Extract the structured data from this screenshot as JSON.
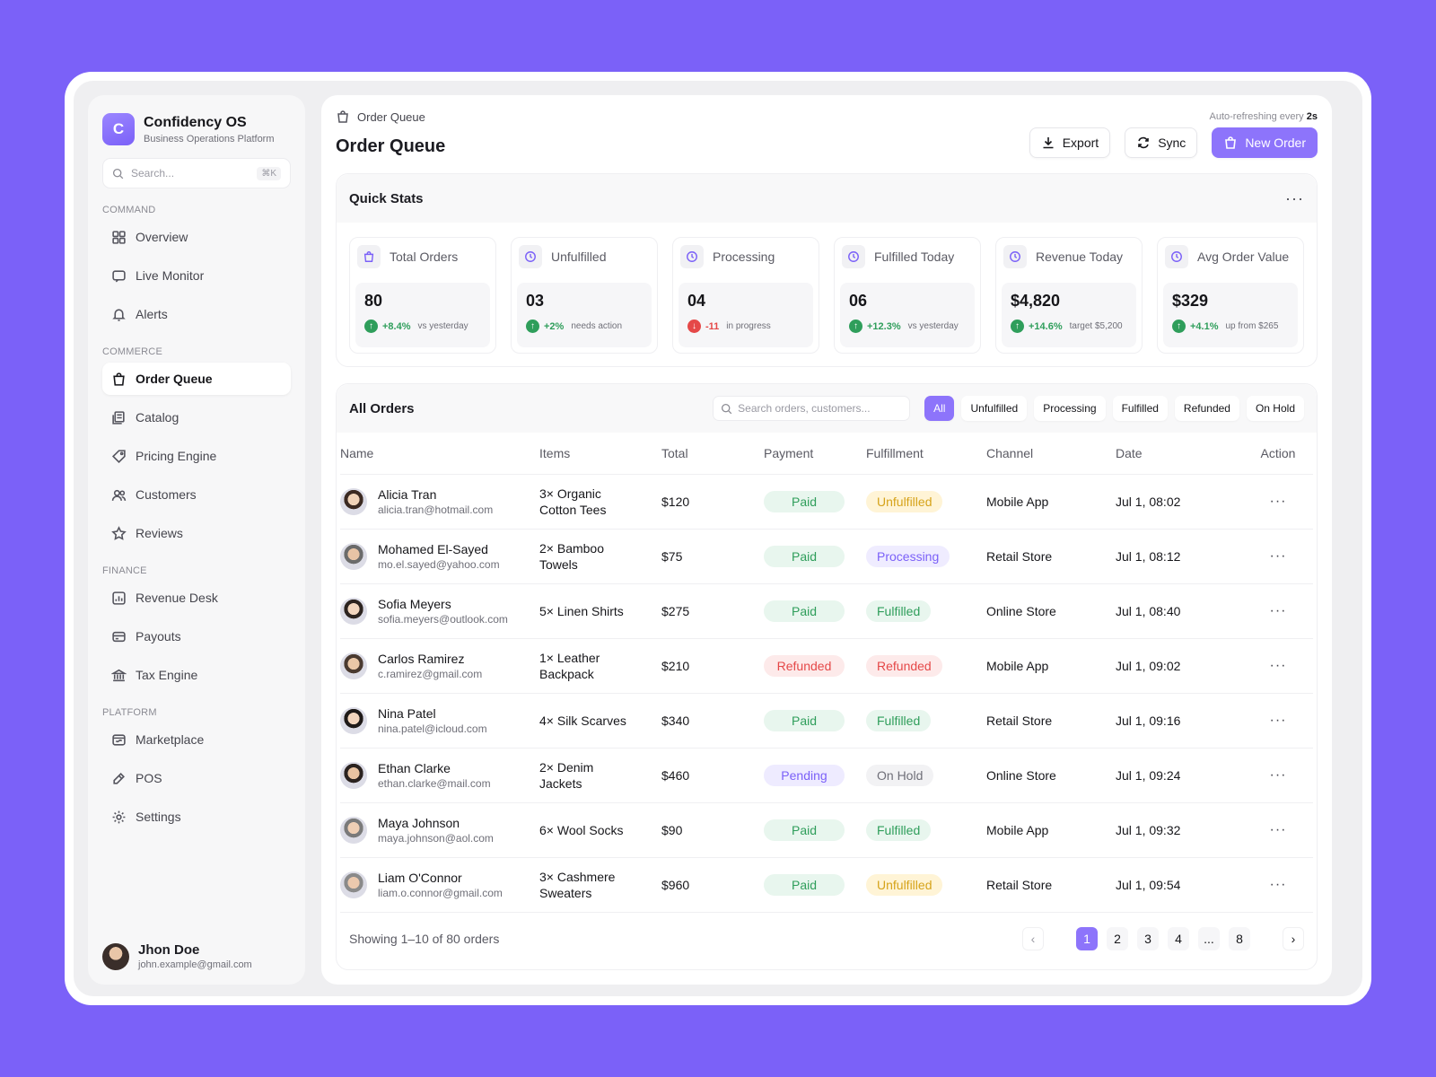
{
  "brand": {
    "logo_letter": "C",
    "title": "Confidency OS",
    "subtitle": "Business Operations Platform"
  },
  "sidebar": {
    "search_placeholder": "Search...",
    "search_shortcut": "⌘K",
    "sections": [
      {
        "label": "COMMAND",
        "items": [
          {
            "label": "Overview",
            "icon": "grid-icon"
          },
          {
            "label": "Live Monitor",
            "icon": "monitor-icon"
          },
          {
            "label": "Alerts",
            "icon": "bell-icon"
          }
        ]
      },
      {
        "label": "COMMERCE",
        "items": [
          {
            "label": "Order Queue",
            "icon": "bag-icon",
            "active": true
          },
          {
            "label": "Catalog",
            "icon": "catalog-icon"
          },
          {
            "label": "Pricing Engine",
            "icon": "tag-icon"
          },
          {
            "label": "Customers",
            "icon": "users-icon"
          },
          {
            "label": "Reviews",
            "icon": "star-icon"
          }
        ]
      },
      {
        "label": "FINANCE",
        "items": [
          {
            "label": "Revenue Desk",
            "icon": "chart-icon"
          },
          {
            "label": "Payouts",
            "icon": "card-icon"
          },
          {
            "label": "Tax Engine",
            "icon": "bank-icon"
          }
        ]
      },
      {
        "label": "PLATFORM",
        "items": [
          {
            "label": "Marketplace",
            "icon": "store-icon"
          },
          {
            "label": "POS",
            "icon": "pos-icon"
          },
          {
            "label": "Settings",
            "icon": "gear-icon"
          }
        ]
      }
    ],
    "user": {
      "name": "Jhon Doe",
      "email": "john.example@gmail.com"
    }
  },
  "header": {
    "breadcrumb": "Order Queue",
    "title": "Order Queue",
    "autorefresh_prefix": "Auto-refreshing every",
    "autorefresh_value": "2s",
    "export_label": "Export",
    "sync_label": "Sync",
    "new_order_label": "New Order"
  },
  "quick_stats": {
    "title": "Quick Stats",
    "more": "···",
    "items": [
      {
        "label": "Total Orders",
        "value": "80",
        "direction": "up",
        "delta": "+8.4%",
        "note": "vs yesterday",
        "icon": "bag-icon"
      },
      {
        "label": "Unfulfilled",
        "value": "03",
        "direction": "up",
        "delta": "+2%",
        "note": "needs action",
        "icon": "clock-icon"
      },
      {
        "label": "Processing",
        "value": "04",
        "direction": "down",
        "delta": "-11",
        "note": "in progress",
        "icon": "clock-icon"
      },
      {
        "label": "Fulfilled Today",
        "value": "06",
        "direction": "up",
        "delta": "+12.3%",
        "note": "vs yesterday",
        "icon": "clock-icon"
      },
      {
        "label": "Revenue Today",
        "value": "$4,820",
        "direction": "up",
        "delta": "+14.6%",
        "note": "target $5,200",
        "icon": "clock-icon"
      },
      {
        "label": "Avg Order Value",
        "value": "$329",
        "direction": "up",
        "delta": "+4.1%",
        "note": "up from $265",
        "icon": "clock-icon"
      }
    ]
  },
  "orders": {
    "title": "All Orders",
    "search_placeholder": "Search orders, customers...",
    "filters": [
      "All",
      "Unfulfilled",
      "Processing",
      "Fulfilled",
      "Refunded",
      "On Hold"
    ],
    "active_filter": "All",
    "columns": [
      "Name",
      "Items",
      "Total",
      "Payment",
      "Fulfillment",
      "Channel",
      "Date",
      "Action"
    ],
    "rows": [
      {
        "name": "Alicia Tran",
        "email": "alicia.tran@hotmail.com",
        "items": "3× Organic Cotton Tees",
        "total": "$120",
        "payment": "Paid",
        "fulfillment": "Unfulfilled",
        "channel": "Mobile App",
        "date": "Jul 1, 08:02"
      },
      {
        "name": "Mohamed El-Sayed",
        "email": "mo.el.sayed@yahoo.com",
        "items": "2× Bamboo Towels",
        "total": "$75",
        "payment": "Paid",
        "fulfillment": "Processing",
        "channel": "Retail Store",
        "date": "Jul 1, 08:12"
      },
      {
        "name": "Sofia Meyers",
        "email": "sofia.meyers@outlook.com",
        "items": "5× Linen Shirts",
        "total": "$275",
        "payment": "Paid",
        "fulfillment": "Fulfilled",
        "channel": "Online Store",
        "date": "Jul 1, 08:40"
      },
      {
        "name": "Carlos Ramirez",
        "email": "c.ramirez@gmail.com",
        "items": "1× Leather Backpack",
        "total": "$210",
        "payment": "Refunded",
        "fulfillment": "Refunded",
        "channel": "Mobile App",
        "date": "Jul 1, 09:02"
      },
      {
        "name": "Nina Patel",
        "email": "nina.patel@icloud.com",
        "items": "4× Silk Scarves",
        "total": "$340",
        "payment": "Paid",
        "fulfillment": "Fulfilled",
        "channel": "Retail Store",
        "date": "Jul 1, 09:16"
      },
      {
        "name": "Ethan Clarke",
        "email": "ethan.clarke@mail.com",
        "items": "2× Denim Jackets",
        "total": "$460",
        "payment": "Pending",
        "fulfillment": "On Hold",
        "channel": "Online Store",
        "date": "Jul 1, 09:24"
      },
      {
        "name": "Maya Johnson",
        "email": "maya.johnson@aol.com",
        "items": "6× Wool Socks",
        "total": "$90",
        "payment": "Paid",
        "fulfillment": "Fulfilled",
        "channel": "Mobile App",
        "date": "Jul 1, 09:32"
      },
      {
        "name": "Liam O'Connor",
        "email": "liam.o.connor@gmail.com",
        "items": "3× Cashmere Sweaters",
        "total": "$960",
        "payment": "Paid",
        "fulfillment": "Unfulfilled",
        "channel": "Retail Store",
        "date": "Jul 1, 09:54"
      }
    ],
    "action_label": "···",
    "footer_text": "Showing 1–10 of 80 orders",
    "pages": [
      "1",
      "2",
      "3",
      "4",
      "...",
      "8"
    ],
    "current_page": "1",
    "prev_icon": "‹",
    "next_icon": "›"
  },
  "colors": {
    "accent": "#8d74fb",
    "background": "#7B61F8",
    "success": "#2f9e5b",
    "danger": "#e54848",
    "warning": "#d6a31a"
  }
}
